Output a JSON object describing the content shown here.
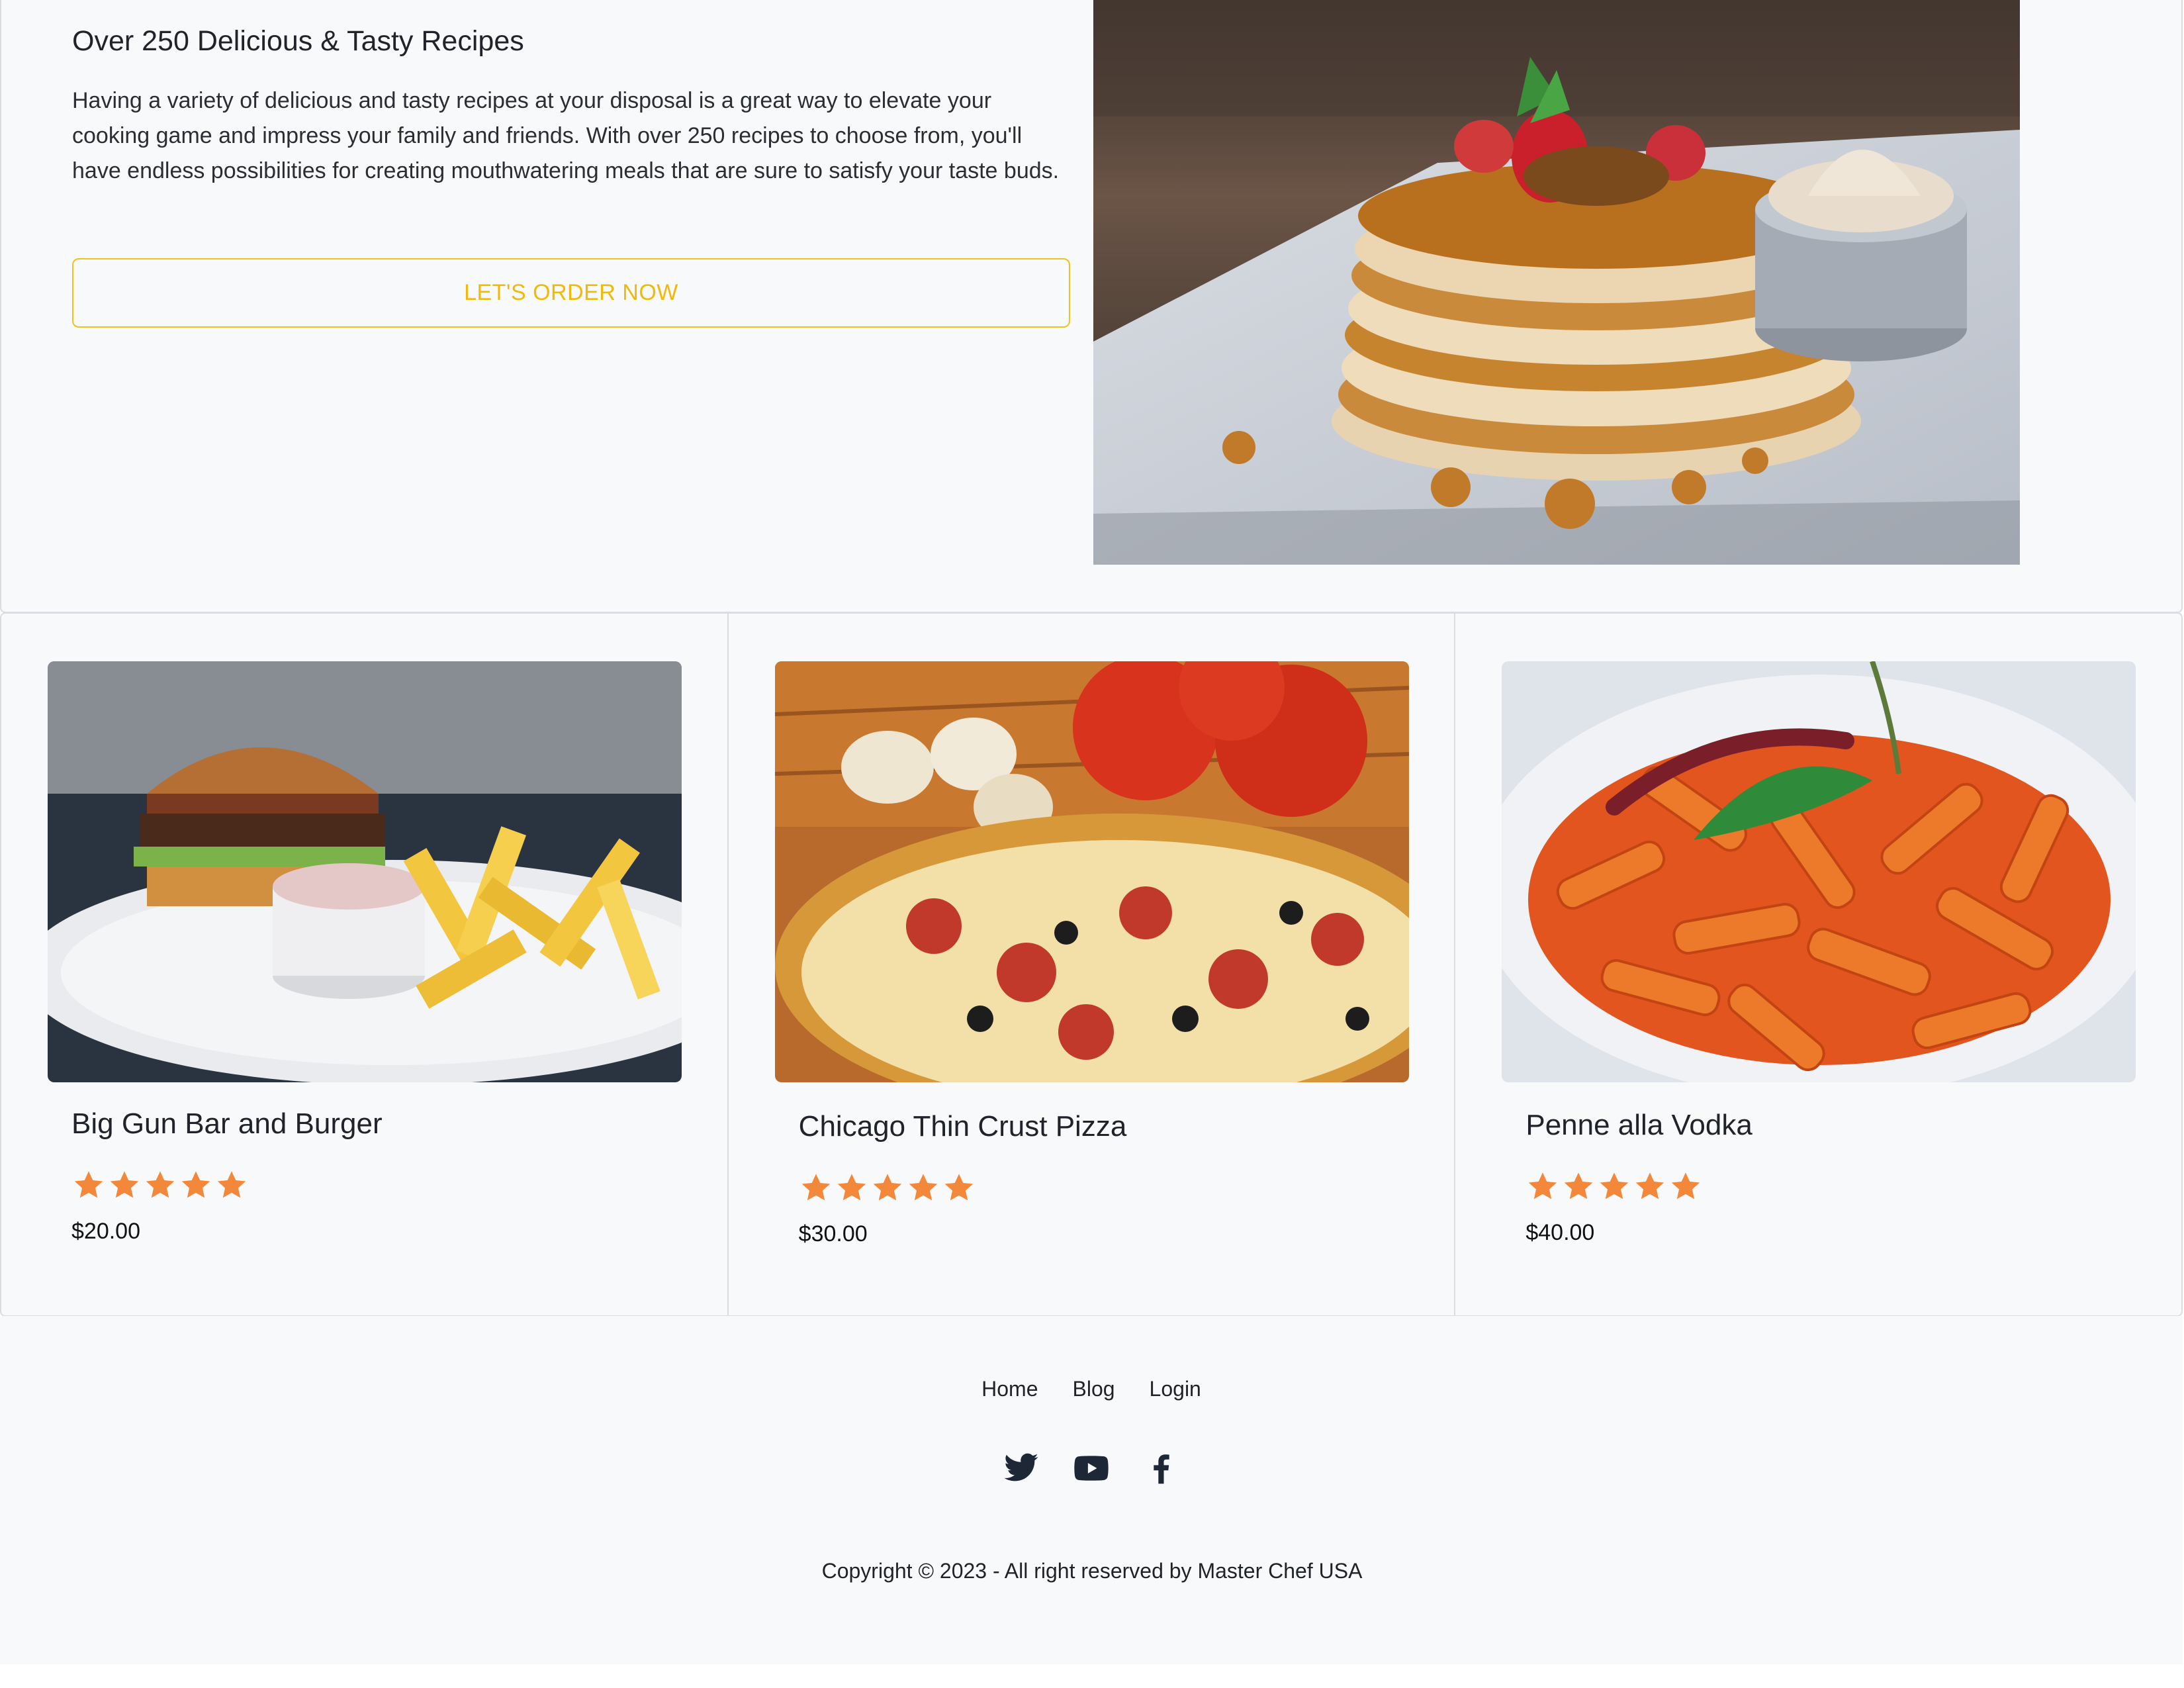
{
  "hero": {
    "title": "Over 250 Delicious & Tasty Recipes",
    "description": "Having a variety of delicious and tasty recipes at your disposal is a great way to elevate your cooking game and impress your family and friends. With over 250 recipes to choose from, you'll have endless possibilities for creating mouthwatering meals that are sure to satisfy your taste buds.",
    "cta_label": "LET'S ORDER NOW"
  },
  "products": [
    {
      "title": "Big Gun Bar and Burger",
      "rating": 5,
      "price": "$20.00"
    },
    {
      "title": "Chicago Thin Crust Pizza",
      "rating": 5,
      "price": "$30.00"
    },
    {
      "title": "Penne alla Vodka",
      "rating": 5,
      "price": "$40.00"
    }
  ],
  "footer": {
    "links": [
      "Home",
      "Blog",
      "Login"
    ],
    "social_icons": [
      "twitter-icon",
      "youtube-icon",
      "facebook-icon"
    ],
    "copyright": "Copyright © 2023 - All right reserved by Master Chef USA"
  },
  "colors": {
    "accent": "#f2c21a",
    "star": "#f4883a",
    "border": "#d9dce1",
    "background": "#f8f9fb",
    "icon": "#1e2736"
  }
}
